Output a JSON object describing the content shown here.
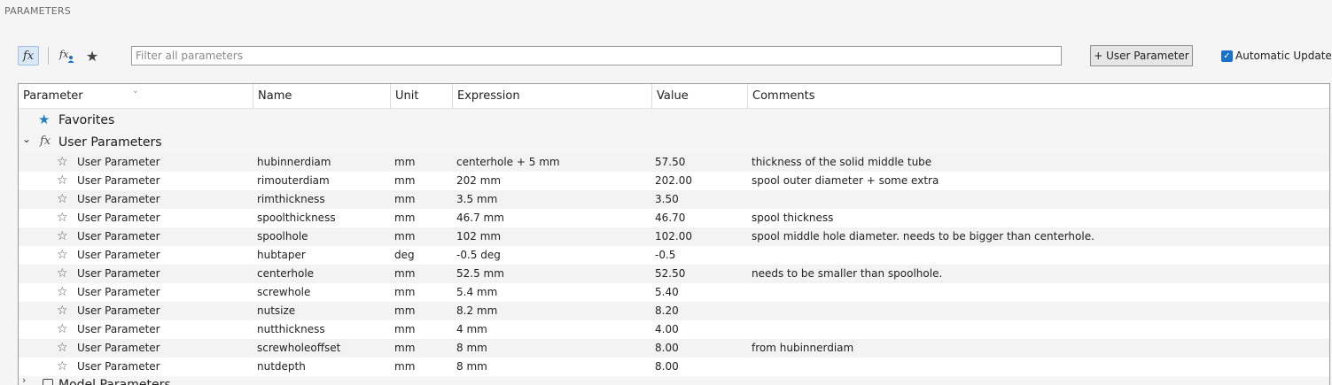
{
  "panel": {
    "title": "PARAMETERS"
  },
  "toolbar": {
    "fx_icon": "fx",
    "user_fx_icon": "fx",
    "favorites_icon": "★",
    "filter_placeholder": "Filter all parameters",
    "filter_value": "",
    "add_button_label": "+ User Parameter",
    "auto_update_label": "Automatic Update",
    "auto_update_checked": true
  },
  "columns": [
    "Parameter",
    "Name",
    "Unit",
    "Expression",
    "Value",
    "Comments"
  ],
  "groups": {
    "favorites": {
      "label": "Favorites",
      "icon": "star-icon",
      "color": "#1f7fc4"
    },
    "user": {
      "label": "User Parameters",
      "icon": "fx-icon",
      "expanded": true
    },
    "model": {
      "label": "Model Parameters",
      "icon": "box-icon"
    }
  },
  "rows": [
    {
      "parameter": "User Parameter",
      "name": "hubinnerdiam",
      "unit": "mm",
      "expression": "centerhole + 5 mm",
      "value": "57.50",
      "comments": "thickness of the solid middle tube"
    },
    {
      "parameter": "User Parameter",
      "name": "rimouterdiam",
      "unit": "mm",
      "expression": "202 mm",
      "value": "202.00",
      "comments": "spool outer diameter + some extra"
    },
    {
      "parameter": "User Parameter",
      "name": "rimthickness",
      "unit": "mm",
      "expression": "3.5 mm",
      "value": "3.50",
      "comments": ""
    },
    {
      "parameter": "User Parameter",
      "name": "spoolthickness",
      "unit": "mm",
      "expression": "46.7 mm",
      "value": "46.70",
      "comments": "spool thickness"
    },
    {
      "parameter": "User Parameter",
      "name": "spoolhole",
      "unit": "mm",
      "expression": "102 mm",
      "value": "102.00",
      "comments": "spool middle hole diameter. needs to be bigger than centerhole."
    },
    {
      "parameter": "User Parameter",
      "name": "hubtaper",
      "unit": "deg",
      "expression": "-0.5 deg",
      "value": "-0.5",
      "comments": ""
    },
    {
      "parameter": "User Parameter",
      "name": "centerhole",
      "unit": "mm",
      "expression": "52.5 mm",
      "value": "52.50",
      "comments": "needs to be smaller than spoolhole."
    },
    {
      "parameter": "User Parameter",
      "name": "screwhole",
      "unit": "mm",
      "expression": "5.4 mm",
      "value": "5.40",
      "comments": ""
    },
    {
      "parameter": "User Parameter",
      "name": "nutsize",
      "unit": "mm",
      "expression": "8.2 mm",
      "value": "8.20",
      "comments": ""
    },
    {
      "parameter": "User Parameter",
      "name": "nutthickness",
      "unit": "mm",
      "expression": "4 mm",
      "value": "4.00",
      "comments": ""
    },
    {
      "parameter": "User Parameter",
      "name": "screwholeoffset",
      "unit": "mm",
      "expression": "8 mm",
      "value": "8.00",
      "comments": "from hubinnerdiam"
    },
    {
      "parameter": "User Parameter",
      "name": "nutdepth",
      "unit": "mm",
      "expression": "8 mm",
      "value": "8.00",
      "comments": ""
    }
  ],
  "colors": {
    "accent": "#1a6fc9",
    "favorite_star": "#1f7fc4"
  }
}
